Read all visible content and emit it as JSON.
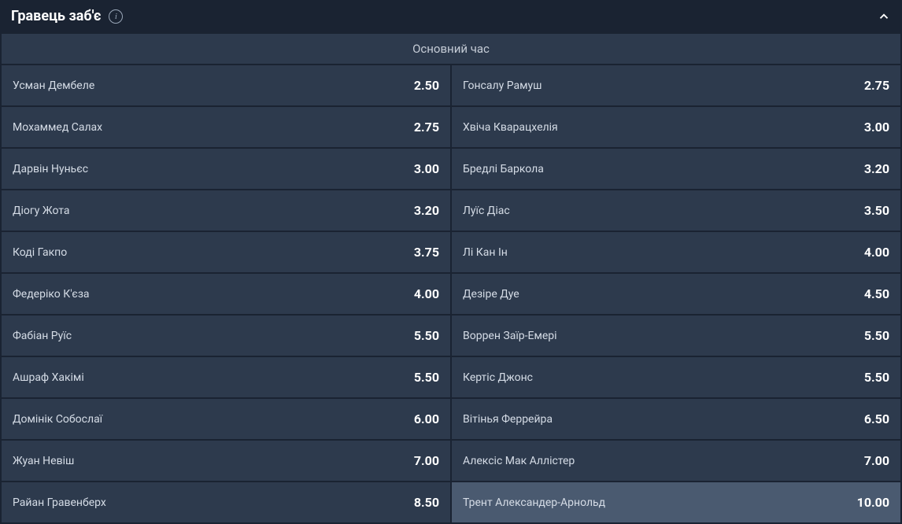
{
  "header": {
    "title": "Гравець заб'є"
  },
  "subheader": "Основний час",
  "rows": [
    {
      "left": {
        "player": "Усман Дембеле",
        "odds": "2.50"
      },
      "right": {
        "player": "Гонсалу Рамуш",
        "odds": "2.75"
      }
    },
    {
      "left": {
        "player": "Мохаммед Салах",
        "odds": "2.75"
      },
      "right": {
        "player": "Хвіча Кварацхелія",
        "odds": "3.00"
      }
    },
    {
      "left": {
        "player": "Дарвін Нуньєс",
        "odds": "3.00"
      },
      "right": {
        "player": "Бредлі Баркола",
        "odds": "3.20"
      }
    },
    {
      "left": {
        "player": "Діогу Жота",
        "odds": "3.20"
      },
      "right": {
        "player": "Луїс Діас",
        "odds": "3.50"
      }
    },
    {
      "left": {
        "player": "Коді Гакпо",
        "odds": "3.75"
      },
      "right": {
        "player": "Лі Кан Ін",
        "odds": "4.00"
      }
    },
    {
      "left": {
        "player": "Федеріко К'єза",
        "odds": "4.00"
      },
      "right": {
        "player": "Дезіре Дуе",
        "odds": "4.50"
      }
    },
    {
      "left": {
        "player": "Фабіан Руїс",
        "odds": "5.50"
      },
      "right": {
        "player": "Воррен Заїр-Емері",
        "odds": "5.50"
      }
    },
    {
      "left": {
        "player": "Ашраф Хакімі",
        "odds": "5.50"
      },
      "right": {
        "player": "Кертіс Джонс",
        "odds": "5.50"
      }
    },
    {
      "left": {
        "player": "Домінік Собослаї",
        "odds": "6.00"
      },
      "right": {
        "player": "Вітінья Феррейра",
        "odds": "6.50"
      }
    },
    {
      "left": {
        "player": "Жуан Невіш",
        "odds": "7.00"
      },
      "right": {
        "player": "Алексіс Мак Аллістер",
        "odds": "7.00"
      }
    },
    {
      "left": {
        "player": "Райан Гравенберх",
        "odds": "8.50"
      },
      "right": {
        "player": "Трент Александер-Арнольд",
        "odds": "10.00",
        "highlighted": true
      }
    }
  ]
}
